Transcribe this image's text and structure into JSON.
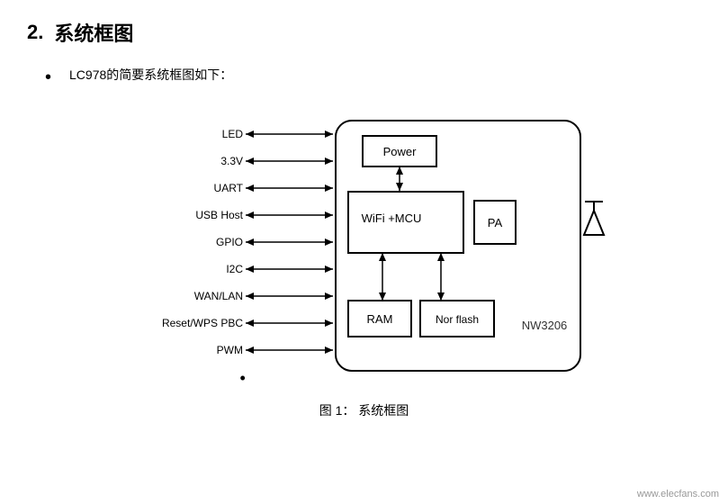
{
  "section": {
    "number": "2.",
    "title": "系统框图"
  },
  "bullet": {
    "text": "LC978的简要系统框图如下："
  },
  "interfaces": [
    {
      "label": "LED"
    },
    {
      "label": "3.3V"
    },
    {
      "label": "UART"
    },
    {
      "label": "USB Host"
    },
    {
      "label": "GPIO"
    },
    {
      "label": "I2C"
    },
    {
      "label": "WAN/LAN"
    },
    {
      "label": "Reset/WPS PBC"
    },
    {
      "label": "PWM"
    }
  ],
  "chip": {
    "power_label": "Power",
    "wifi_label": "WiFi +MCU",
    "pa_label": "PA",
    "ram_label": "RAM",
    "norflash_label": "Nor flash",
    "chip_name": "NW3206"
  },
  "figure_caption": "图 1：   系统框图",
  "watermark": "www.elecfans.com"
}
